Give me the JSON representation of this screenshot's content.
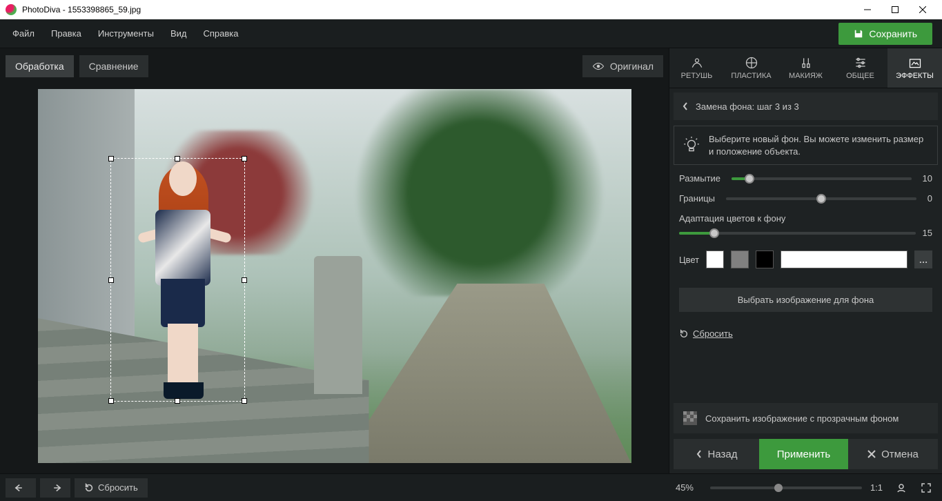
{
  "titlebar": {
    "app": "PhotoDiva",
    "filename": "1553398865_59.jpg"
  },
  "menu": {
    "file": "Файл",
    "edit": "Правка",
    "tools": "Инструменты",
    "view": "Вид",
    "help": "Справка"
  },
  "save_button": "Сохранить",
  "mode_tabs": {
    "processing": "Обработка",
    "compare": "Сравнение"
  },
  "original_button": "Оригинал",
  "tool_tabs": {
    "retouch": "РЕТУШЬ",
    "plastic": "ПЛАСТИКА",
    "makeup": "МАКИЯЖ",
    "general": "ОБЩЕЕ",
    "effects": "ЭФФЕКТЫ"
  },
  "breadcrumb": "Замена фона: шаг 3 из 3",
  "hint": "Выберите новый фон. Вы можете изменить размер и положение объекта.",
  "sliders": {
    "blur": {
      "label": "Размытие",
      "value": 10,
      "max": 100
    },
    "borders": {
      "label": "Границы",
      "value": 0,
      "max": 100,
      "thumb_pct": 50
    },
    "adapt": {
      "label": "Адаптация цветов к фону",
      "value": 15,
      "max": 100
    }
  },
  "color_label": "Цвет",
  "colors": {
    "white": "#ffffff",
    "gray": "#808080",
    "black": "#000000",
    "selected": "#ffffff"
  },
  "choose_bg_image": "Выбрать изображение для фона",
  "reset_link": "Сбросить",
  "save_transparent": "Сохранить изображение с прозрачным фоном",
  "actions": {
    "back": "Назад",
    "apply": "Применить",
    "cancel": "Отмена"
  },
  "bottom": {
    "reset": "Сбросить",
    "zoom_percent": "45%",
    "ratio": "1:1"
  }
}
